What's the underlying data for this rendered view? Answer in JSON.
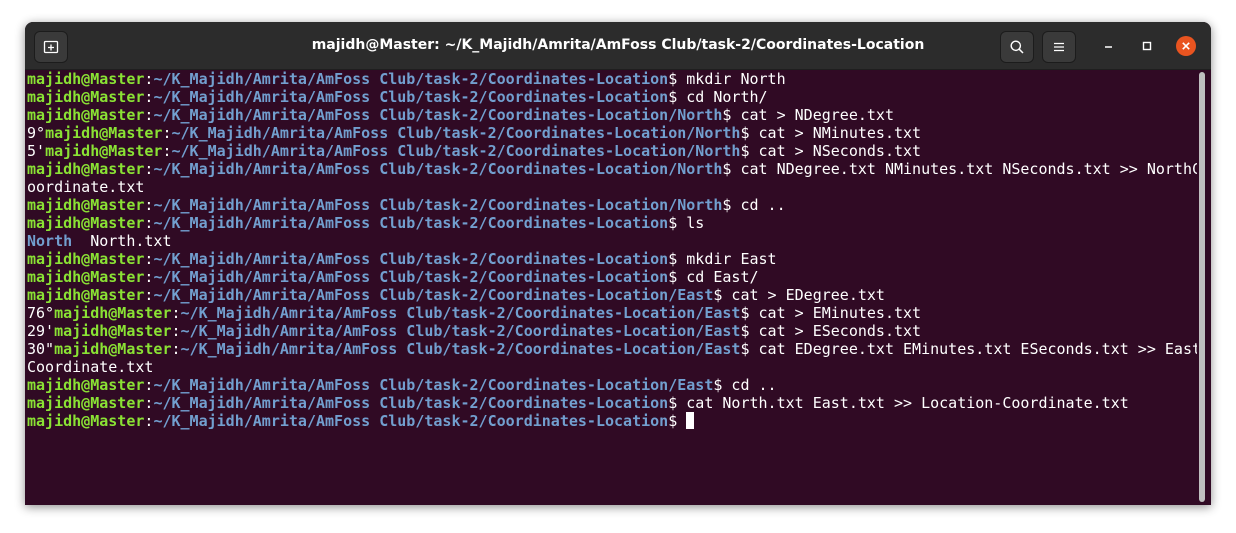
{
  "window": {
    "title": "majidh@Master: ~/K_Majidh/Amrita/AmFoss Club/task-2/Coordinates-Location",
    "icons": {
      "new_tab": "new-tab-icon",
      "search": "search-icon",
      "menu": "hamburger-menu-icon",
      "minimize": "minimize-icon",
      "maximize": "maximize-icon",
      "close": "close-icon"
    },
    "colors": {
      "background": "#300a24",
      "user": "#8ae234",
      "path": "#729fcf",
      "close": "#e95420"
    }
  },
  "terminal": {
    "lines": [
      {
        "pre": "",
        "user": "majidh@Master",
        "sep": ":",
        "path": "~/K_Majidh/Amrita/AmFoss Club/task-2/Coordinates-Location",
        "cmd": "$ mkdir North"
      },
      {
        "pre": "",
        "user": "majidh@Master",
        "sep": ":",
        "path": "~/K_Majidh/Amrita/AmFoss Club/task-2/Coordinates-Location",
        "cmd": "$ cd North/"
      },
      {
        "pre": "",
        "user": "majidh@Master",
        "sep": ":",
        "path": "~/K_Majidh/Amrita/AmFoss Club/task-2/Coordinates-Location/North",
        "cmd": "$ cat > NDegree.txt"
      },
      {
        "pre": "9°",
        "user": "majidh@Master",
        "sep": ":",
        "path": "~/K_Majidh/Amrita/AmFoss Club/task-2/Coordinates-Location/North",
        "cmd": "$ cat > NMinutes.txt"
      },
      {
        "pre": "5'",
        "user": "majidh@Master",
        "sep": ":",
        "path": "~/K_Majidh/Amrita/AmFoss Club/task-2/Coordinates-Location/North",
        "cmd": "$ cat > NSeconds.txt"
      },
      {
        "pre": "",
        "user": "majidh@Master",
        "sep": ":",
        "path": "~/K_Majidh/Amrita/AmFoss Club/task-2/Coordinates-Location/North",
        "cmd": "$ cat NDegree.txt NMinutes.txt NSeconds.txt >> NorthC"
      },
      {
        "text": "oordinate.txt"
      },
      {
        "pre": "",
        "user": "majidh@Master",
        "sep": ":",
        "path": "~/K_Majidh/Amrita/AmFoss Club/task-2/Coordinates-Location/North",
        "cmd": "$ cd .."
      },
      {
        "pre": "",
        "user": "majidh@Master",
        "sep": ":",
        "path": "~/K_Majidh/Amrita/AmFoss Club/task-2/Coordinates-Location",
        "cmd": "$ ls"
      },
      {
        "dir": "North",
        "text": "  North.txt"
      },
      {
        "pre": "",
        "user": "majidh@Master",
        "sep": ":",
        "path": "~/K_Majidh/Amrita/AmFoss Club/task-2/Coordinates-Location",
        "cmd": "$ mkdir East"
      },
      {
        "pre": "",
        "user": "majidh@Master",
        "sep": ":",
        "path": "~/K_Majidh/Amrita/AmFoss Club/task-2/Coordinates-Location",
        "cmd": "$ cd East/"
      },
      {
        "pre": "",
        "user": "majidh@Master",
        "sep": ":",
        "path": "~/K_Majidh/Amrita/AmFoss Club/task-2/Coordinates-Location/East",
        "cmd": "$ cat > EDegree.txt"
      },
      {
        "pre": "76°",
        "user": "majidh@Master",
        "sep": ":",
        "path": "~/K_Majidh/Amrita/AmFoss Club/task-2/Coordinates-Location/East",
        "cmd": "$ cat > EMinutes.txt"
      },
      {
        "pre": "29'",
        "user": "majidh@Master",
        "sep": ":",
        "path": "~/K_Majidh/Amrita/AmFoss Club/task-2/Coordinates-Location/East",
        "cmd": "$ cat > ESeconds.txt"
      },
      {
        "pre": "30\"",
        "user": "majidh@Master",
        "sep": ":",
        "path": "~/K_Majidh/Amrita/AmFoss Club/task-2/Coordinates-Location/East",
        "cmd": "$ cat EDegree.txt EMinutes.txt ESeconds.txt >> East"
      },
      {
        "text": "Coordinate.txt"
      },
      {
        "pre": "",
        "user": "majidh@Master",
        "sep": ":",
        "path": "~/K_Majidh/Amrita/AmFoss Club/task-2/Coordinates-Location/East",
        "cmd": "$ cd .."
      },
      {
        "pre": "",
        "user": "majidh@Master",
        "sep": ":",
        "path": "~/K_Majidh/Amrita/AmFoss Club/task-2/Coordinates-Location",
        "cmd": "$ cat North.txt East.txt >> Location-Coordinate.txt"
      },
      {
        "pre": "",
        "user": "majidh@Master",
        "sep": ":",
        "path": "~/K_Majidh/Amrita/AmFoss Club/task-2/Coordinates-Location",
        "cmd": "$ ",
        "cursor": true
      }
    ]
  }
}
